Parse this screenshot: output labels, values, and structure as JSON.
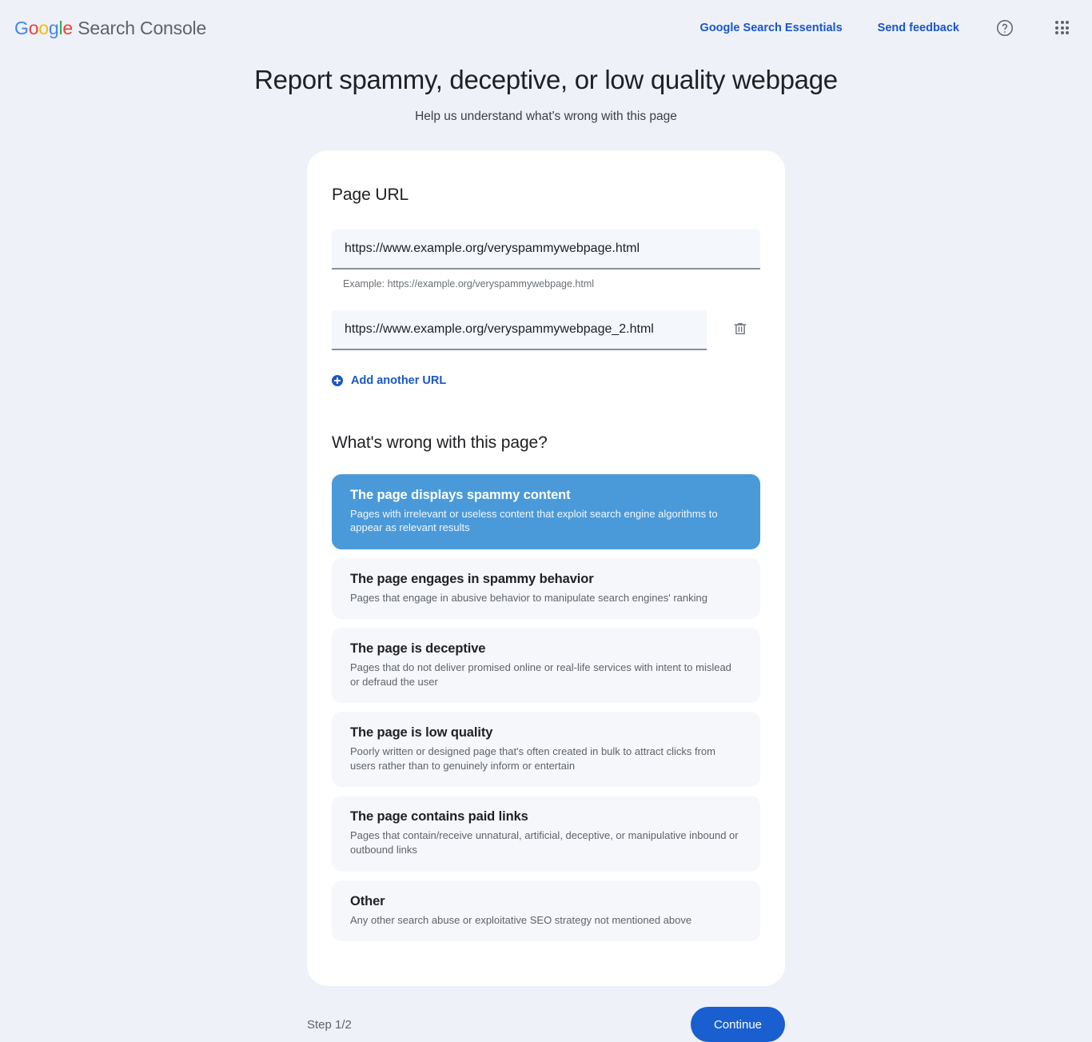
{
  "header": {
    "brand": {
      "google": [
        "G",
        "o",
        "o",
        "g",
        "l",
        "e"
      ],
      "suffix": " Search Console"
    },
    "links": [
      {
        "label": "Google Search Essentials",
        "name": "google-search-essentials-link"
      },
      {
        "label": "Send feedback",
        "name": "send-feedback-link"
      }
    ],
    "help_icon": "help-circle-icon",
    "apps_icon": "apps-grid-icon"
  },
  "page": {
    "title": "Report spammy, deceptive, or low quality webpage",
    "subtitle": "Help us understand what's wrong with this page"
  },
  "url_section": {
    "heading": "Page URL",
    "fields": [
      {
        "value": "https://www.example.org/veryspammywebpage.html",
        "placeholder": "https://example.org/page.html"
      },
      {
        "value": "https://www.example.org/veryspammywebpage_2.html",
        "placeholder": "https://example.org/page.html"
      }
    ],
    "helper_text": "Example: https://example.org/veryspammywebpage.html",
    "delete_icon": "trash-icon",
    "add_another": {
      "label": "Add another URL",
      "icon": "plus-circle-icon"
    }
  },
  "reasons_section": {
    "heading": "What's wrong with this page?",
    "options": [
      {
        "title": "The page displays spammy content",
        "description": "Pages with irrelevant or useless content that exploit search engine algorithms to appear as relevant results",
        "selected": true
      },
      {
        "title": "The page engages in spammy behavior",
        "description": "Pages that engage in abusive behavior to manipulate search engines' ranking",
        "selected": false
      },
      {
        "title": "The page is deceptive",
        "description": "Pages that do not deliver promised online or real-life services with intent to mislead or defraud the user",
        "selected": false
      },
      {
        "title": "The page is low quality",
        "description": "Poorly written or designed page that's often created in bulk to attract clicks from users rather than to genuinely inform or entertain",
        "selected": false
      },
      {
        "title": "The page contains paid links",
        "description": "Pages that contain/receive unnatural, artificial, deceptive, or manipulative inbound or outbound links",
        "selected": false
      },
      {
        "title": "Other",
        "description": "Any other search abuse or exploitative SEO strategy not mentioned above",
        "selected": false
      }
    ]
  },
  "footer": {
    "step_text": "Step 1/2",
    "continue_label": "Continue"
  },
  "colors": {
    "page_background": "#eef1f7",
    "card_background": "#ffffff",
    "link_blue": "#1a56c7",
    "primary_button": "#1a5fd0",
    "selected_option": "#4a9ad9",
    "option_background": "#f5f7fb",
    "field_background": "#f4f7fc",
    "google_blue": "#4285f4",
    "google_red": "#ea4335",
    "google_yellow": "#fbbc05",
    "google_green": "#34a853"
  }
}
